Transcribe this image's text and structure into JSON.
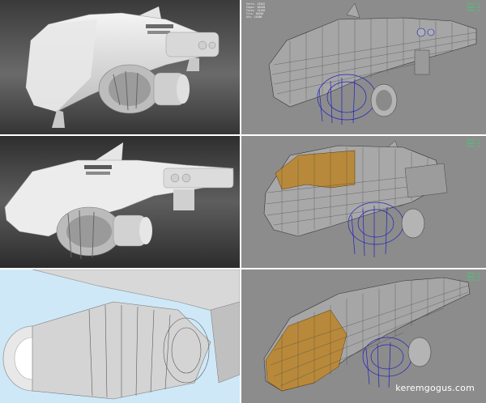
{
  "watermark": {
    "text": "keremgogus.com"
  },
  "colors": {
    "render_bg_dark": "#5a5a5a",
    "render_bg_mid": "#3e3e3e",
    "viewport_bg": "#8c8c8c",
    "sky_bg": "#cfe8f7",
    "body_white": "#ececec",
    "wire_blue": "#2020c0",
    "panel_orange": "#b8893a",
    "hud_green": "#2ee070"
  },
  "hud_top_right": [
    {
      "k": "Verts:",
      "v": "13342"
    },
    {
      "k": "Edges:",
      "v": "26540"
    },
    {
      "k": "Faces:",
      "v": "13156"
    },
    {
      "k": "Tris:",
      "v": "26250"
    },
    {
      "k": "UVs:",
      "v": "14108"
    }
  ],
  "hud_side": [
    {
      "k": "Verts:",
      "v": "0"
    },
    {
      "k": "Edges:",
      "v": "0"
    },
    {
      "k": "Faces:",
      "v": "0"
    },
    {
      "k": "Tris:",
      "v": "0"
    },
    {
      "k": "UVs:",
      "v": "0"
    }
  ]
}
